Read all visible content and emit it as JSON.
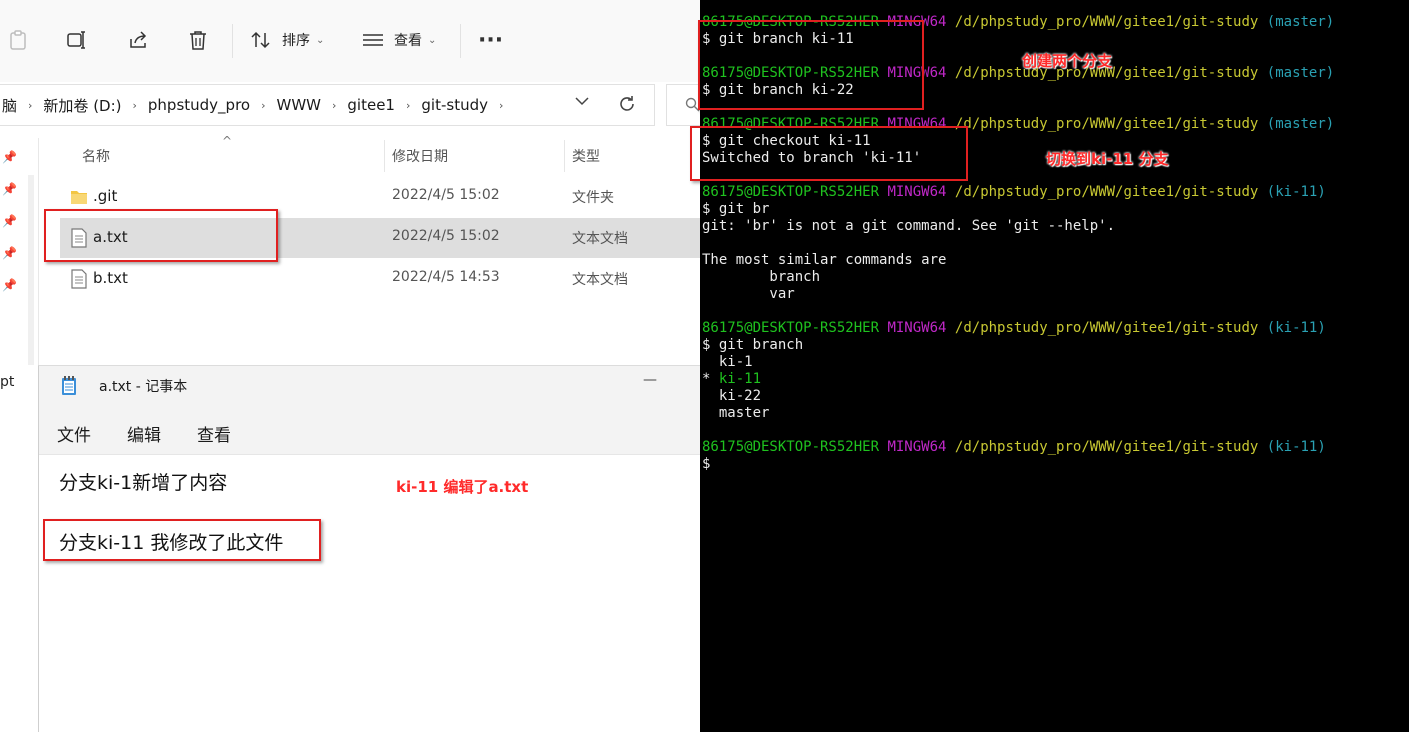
{
  "explorer": {
    "toolbar": {
      "sort_label": "排序",
      "view_label": "查看",
      "more_label": "···"
    },
    "breadcrumbs": [
      "脑",
      "新加卷 (D:)",
      "phpstudy_pro",
      "WWW",
      "gitee1",
      "git-study"
    ],
    "columns": {
      "name": "名称",
      "modified": "修改日期",
      "type": "类型"
    },
    "files": [
      {
        "name": ".git",
        "modified": "2022/4/5 15:02",
        "type": "文件夹",
        "icon": "folder-icon",
        "selected": false
      },
      {
        "name": "a.txt",
        "modified": "2022/4/5 15:02",
        "type": "文本文档",
        "icon": "text-file-icon",
        "selected": true
      },
      {
        "name": "b.txt",
        "modified": "2022/4/5 14:53",
        "type": "文本文档",
        "icon": "text-file-icon",
        "selected": false
      }
    ],
    "nav_cut_text": "pt"
  },
  "notepad": {
    "title": "a.txt - 记事本",
    "menu": [
      "文件",
      "编辑",
      "查看"
    ],
    "lines": [
      "分支ki-1新增了内容",
      "分支ki-11 我修改了此文件"
    ]
  },
  "terminal": {
    "lines": [
      {
        "type": "prompt",
        "user": "86175@DESKTOP-RS52HER",
        "env": "MINGW64",
        "path": "/d/phpstudy_pro/WWW/gitee1/git-study",
        "branch": "(master)"
      },
      {
        "type": "text",
        "text": "$ git branch ki-11"
      },
      {
        "type": "text",
        "text": ""
      },
      {
        "type": "prompt",
        "user": "86175@DESKTOP-RS52HER",
        "env": "MINGW64",
        "path": "/d/phpstudy_pro/WWW/gitee1/git-study",
        "branch": "(master)"
      },
      {
        "type": "text",
        "text": "$ git branch ki-22"
      },
      {
        "type": "text",
        "text": ""
      },
      {
        "type": "prompt",
        "user": "86175@DESKTOP-RS52HER",
        "env": "MINGW64",
        "path": "/d/phpstudy_pro/WWW/gitee1/git-study",
        "branch": "(master)"
      },
      {
        "type": "text",
        "text": "$ git checkout ki-11"
      },
      {
        "type": "text",
        "text": "Switched to branch 'ki-11'"
      },
      {
        "type": "text",
        "text": ""
      },
      {
        "type": "prompt",
        "user": "86175@DESKTOP-RS52HER",
        "env": "MINGW64",
        "path": "/d/phpstudy_pro/WWW/gitee1/git-study",
        "branch": "(ki-11)"
      },
      {
        "type": "text",
        "text": "$ git br"
      },
      {
        "type": "text",
        "text": "git: 'br' is not a git command. See 'git --help'."
      },
      {
        "type": "text",
        "text": ""
      },
      {
        "type": "text",
        "text": "The most similar commands are"
      },
      {
        "type": "text",
        "text": "        branch"
      },
      {
        "type": "text",
        "text": "        var"
      },
      {
        "type": "text",
        "text": ""
      },
      {
        "type": "prompt",
        "user": "86175@DESKTOP-RS52HER",
        "env": "MINGW64",
        "path": "/d/phpstudy_pro/WWW/gitee1/git-study",
        "branch": "(ki-11)"
      },
      {
        "type": "text",
        "text": "$ git branch"
      },
      {
        "type": "text",
        "text": "  ki-1"
      },
      {
        "type": "current",
        "prefix": "* ",
        "text": "ki-11"
      },
      {
        "type": "text",
        "text": "  ki-22"
      },
      {
        "type": "text",
        "text": "  master"
      },
      {
        "type": "text",
        "text": ""
      },
      {
        "type": "prompt",
        "user": "86175@DESKTOP-RS52HER",
        "env": "MINGW64",
        "path": "/d/phpstudy_pro/WWW/gitee1/git-study",
        "branch": "(ki-11)"
      },
      {
        "type": "text",
        "text": "$"
      }
    ]
  },
  "annotations": {
    "create_branches": "创建两个分支",
    "switch_branch": "切换到ki-11 分支",
    "edit_file": "ki-11 编辑了a.txt"
  },
  "colors": {
    "annotation_red": "#e02020",
    "prompt_green": "#1fc21f",
    "prompt_magenta": "#c028c8",
    "path_yellow": "#c8c832",
    "branch_cyan": "#2aa1b3"
  }
}
